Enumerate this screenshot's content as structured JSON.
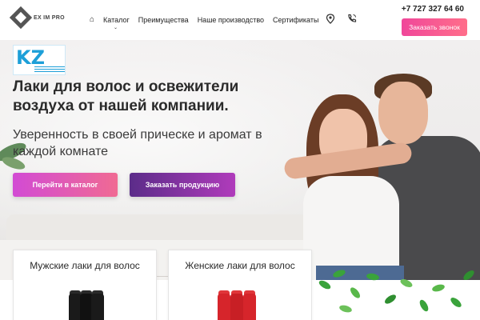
{
  "header": {
    "logo_text": "EX IM PRO",
    "nav": {
      "catalog": "Каталог",
      "advantages": "Преимущества",
      "production": "Наше производство",
      "certificates": "Сертификаты"
    },
    "phone": "+7 727 327 64 60",
    "call_button": "Заказать звонок",
    "icons": [
      "home-icon",
      "location-icon",
      "phone-icon",
      "chevron-down-icon"
    ]
  },
  "hero": {
    "badge_mark": "KZ",
    "title": "Лаки для волос и освежители воздуха от нашей компании.",
    "subtitle": "Уверенность в своей прическе и аромат в каждой комнате",
    "catalog_button": "Перейти в каталог",
    "order_button": "Заказать продукцию"
  },
  "cards": {
    "men": "Мужские лаки для волос",
    "women": "Женские лаки для волос"
  },
  "colors": {
    "call_button": "#f0479a",
    "catalog_button": "#d24bd4",
    "order_button": "#5b2c89",
    "badge": "#1d9fd8",
    "men_can": "#1a1a1a",
    "women_can": "#d6252b"
  }
}
